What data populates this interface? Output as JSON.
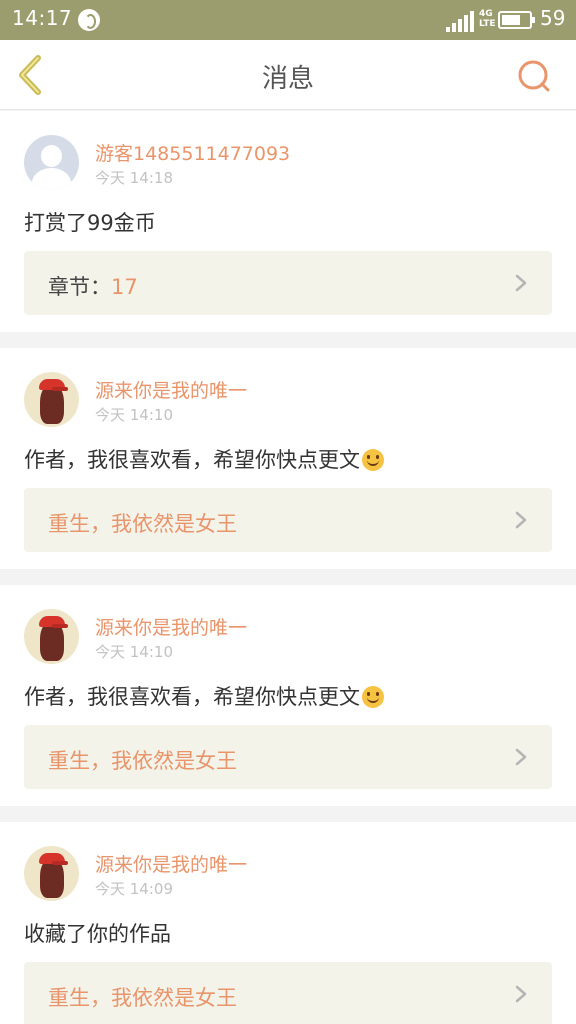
{
  "status_bar": {
    "time": "14:17",
    "network": "4G",
    "network_sub": "LTE",
    "battery": "59"
  },
  "nav": {
    "title": "消息",
    "back_icon": "chevron-left-icon",
    "search_icon": "search-icon",
    "accent_color": "#e8956b"
  },
  "messages": [
    {
      "username": "游客1485511477093",
      "time": "今天 14:18",
      "text": "打赏了99金币",
      "link_label": "章节：",
      "link_value": "17"
    },
    {
      "username": "源来你是我的唯一",
      "time": "今天 14:10",
      "text": "作者，我很喜欢看，希望你快点更文",
      "link_title": "重生，我依然是女王"
    },
    {
      "username": "源来你是我的唯一",
      "time": "今天 14:10",
      "text": "作者，我很喜欢看，希望你快点更文",
      "link_title": "重生，我依然是女王"
    },
    {
      "username": "源来你是我的唯一",
      "time": "今天 14:09",
      "text": "收藏了你的作品",
      "link_title": "重生，我依然是女王"
    }
  ]
}
